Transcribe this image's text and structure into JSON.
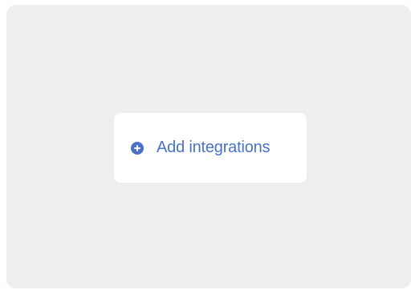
{
  "add_integrations": {
    "label": "Add integrations",
    "icon": "plus-circle-icon",
    "accent_color": "#4a72c8"
  },
  "colors": {
    "panel_background": "#efeeec",
    "card_background": "#ffffff"
  }
}
